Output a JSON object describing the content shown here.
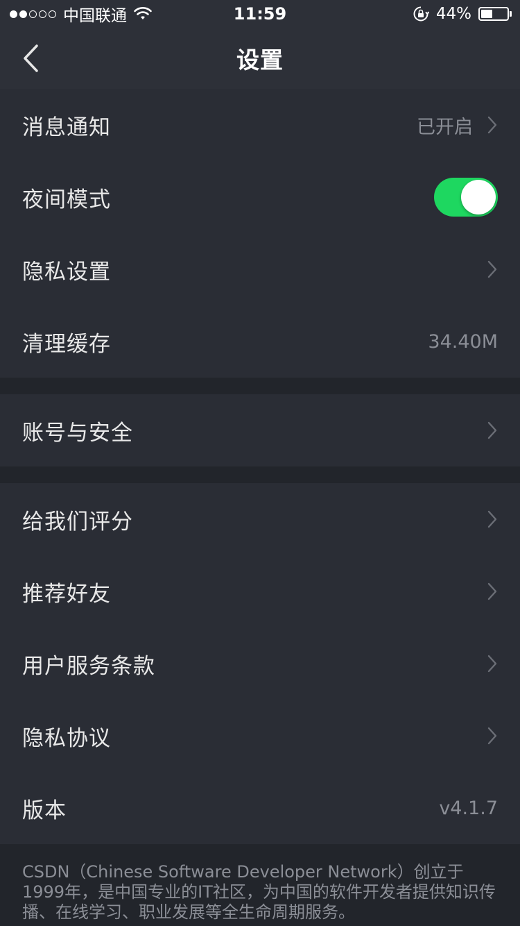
{
  "status_bar": {
    "carrier": "中国联通",
    "time": "11:59",
    "battery_text": "44%",
    "battery_level": 0.44,
    "signal_bars": 2,
    "signal_total": 5
  },
  "nav": {
    "title": "设置",
    "back_icon": "chevron-left-icon"
  },
  "group1": {
    "notification": {
      "label": "消息通知",
      "value": "已开启"
    },
    "night_mode": {
      "label": "夜间模式",
      "enabled": true
    },
    "privacy_settings": {
      "label": "隐私设置"
    },
    "clear_cache": {
      "label": "清理缓存",
      "value": "34.40M"
    }
  },
  "group2": {
    "account_security": {
      "label": "账号与安全"
    }
  },
  "group3": {
    "rate_us": {
      "label": "给我们评分"
    },
    "recommend_friends": {
      "label": "推荐好友"
    },
    "terms": {
      "label": "用户服务条款"
    },
    "privacy_policy": {
      "label": "隐私协议"
    },
    "version": {
      "label": "版本",
      "value": "v4.1.7"
    }
  },
  "footer": {
    "text": "CSDN（Chinese Software Developer Network）创立于1999年，是中国专业的IT社区，为中国的软件开发者提供知识传播、在线学习、职业发展等全生命周期服务。"
  },
  "colors": {
    "background": "#22252b",
    "panel": "#2a2d35",
    "bar": "#2d3038",
    "toggle_on": "#1ed760",
    "secondary_text": "#8b8e96"
  }
}
